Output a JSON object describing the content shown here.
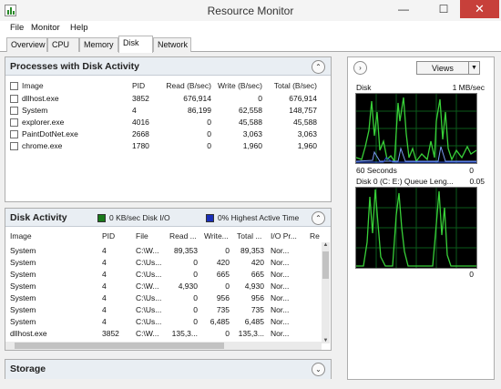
{
  "window": {
    "title": "Resource Monitor",
    "minimize": "—",
    "maximize": "☐",
    "close": "✕"
  },
  "menu": [
    "File",
    "Monitor",
    "Help"
  ],
  "tabs": [
    "Overview",
    "CPU",
    "Memory",
    "Disk",
    "Network"
  ],
  "active_tab": "Disk",
  "processes_panel": {
    "title": "Processes with Disk Activity",
    "columns": [
      "Image",
      "PID",
      "Read (B/sec)",
      "Write (B/sec)",
      "Total (B/sec)"
    ],
    "rows": [
      {
        "image": "dllhost.exe",
        "pid": "3852",
        "read": "676,914",
        "write": "0",
        "total": "676,914"
      },
      {
        "image": "System",
        "pid": "4",
        "read": "86,199",
        "write": "62,558",
        "total": "148,757"
      },
      {
        "image": "explorer.exe",
        "pid": "4016",
        "read": "0",
        "write": "45,588",
        "total": "45,588"
      },
      {
        "image": "PaintDotNet.exe",
        "pid": "2668",
        "read": "0",
        "write": "3,063",
        "total": "3,063"
      },
      {
        "image": "chrome.exe",
        "pid": "1780",
        "read": "0",
        "write": "1,960",
        "total": "1,960"
      }
    ]
  },
  "disk_activity_panel": {
    "title": "Disk Activity",
    "legend_io": "0 KB/sec Disk I/O",
    "legend_active": "0% Highest Active Time",
    "legend_io_color": "#1a7a1a",
    "legend_active_color": "#1a2fb8",
    "columns": [
      "Image",
      "PID",
      "File",
      "Read ...",
      "Write...",
      "Total ...",
      "I/O Pr...",
      "Re"
    ],
    "rows": [
      {
        "image": "System",
        "pid": "4",
        "file": "C:\\W...",
        "read": "89,353",
        "write": "0",
        "total": "89,353",
        "prio": "Nor..."
      },
      {
        "image": "System",
        "pid": "4",
        "file": "C:\\Us...",
        "read": "0",
        "write": "420",
        "total": "420",
        "prio": "Nor..."
      },
      {
        "image": "System",
        "pid": "4",
        "file": "C:\\Us...",
        "read": "0",
        "write": "665",
        "total": "665",
        "prio": "Nor..."
      },
      {
        "image": "System",
        "pid": "4",
        "file": "C:\\W...",
        "read": "4,930",
        "write": "0",
        "total": "4,930",
        "prio": "Nor..."
      },
      {
        "image": "System",
        "pid": "4",
        "file": "C:\\Us...",
        "read": "0",
        "write": "956",
        "total": "956",
        "prio": "Nor..."
      },
      {
        "image": "System",
        "pid": "4",
        "file": "C:\\Us...",
        "read": "0",
        "write": "735",
        "total": "735",
        "prio": "Nor..."
      },
      {
        "image": "System",
        "pid": "4",
        "file": "C:\\Us...",
        "read": "0",
        "write": "6,485",
        "total": "6,485",
        "prio": "Nor..."
      },
      {
        "image": "dllhost.exe",
        "pid": "3852",
        "file": "C:\\W...",
        "read": "135,3...",
        "write": "0",
        "total": "135,3...",
        "prio": "Nor..."
      },
      {
        "image": "dllhost.exe",
        "pid": "3852",
        "file": "C:\\W...",
        "read": "135,3...",
        "write": "0",
        "total": "135,3...",
        "prio": "Nor..."
      }
    ]
  },
  "storage_panel": {
    "title": "Storage"
  },
  "graphs": {
    "views_label": "Views",
    "disk_graph": {
      "title": "Disk",
      "scale": "1 MB/sec",
      "time": "60 Seconds",
      "min": "0"
    },
    "queue_graph": {
      "title": "Disk 0 (C: E:) Queue Leng...",
      "scale": "0.05",
      "min": "0"
    }
  }
}
